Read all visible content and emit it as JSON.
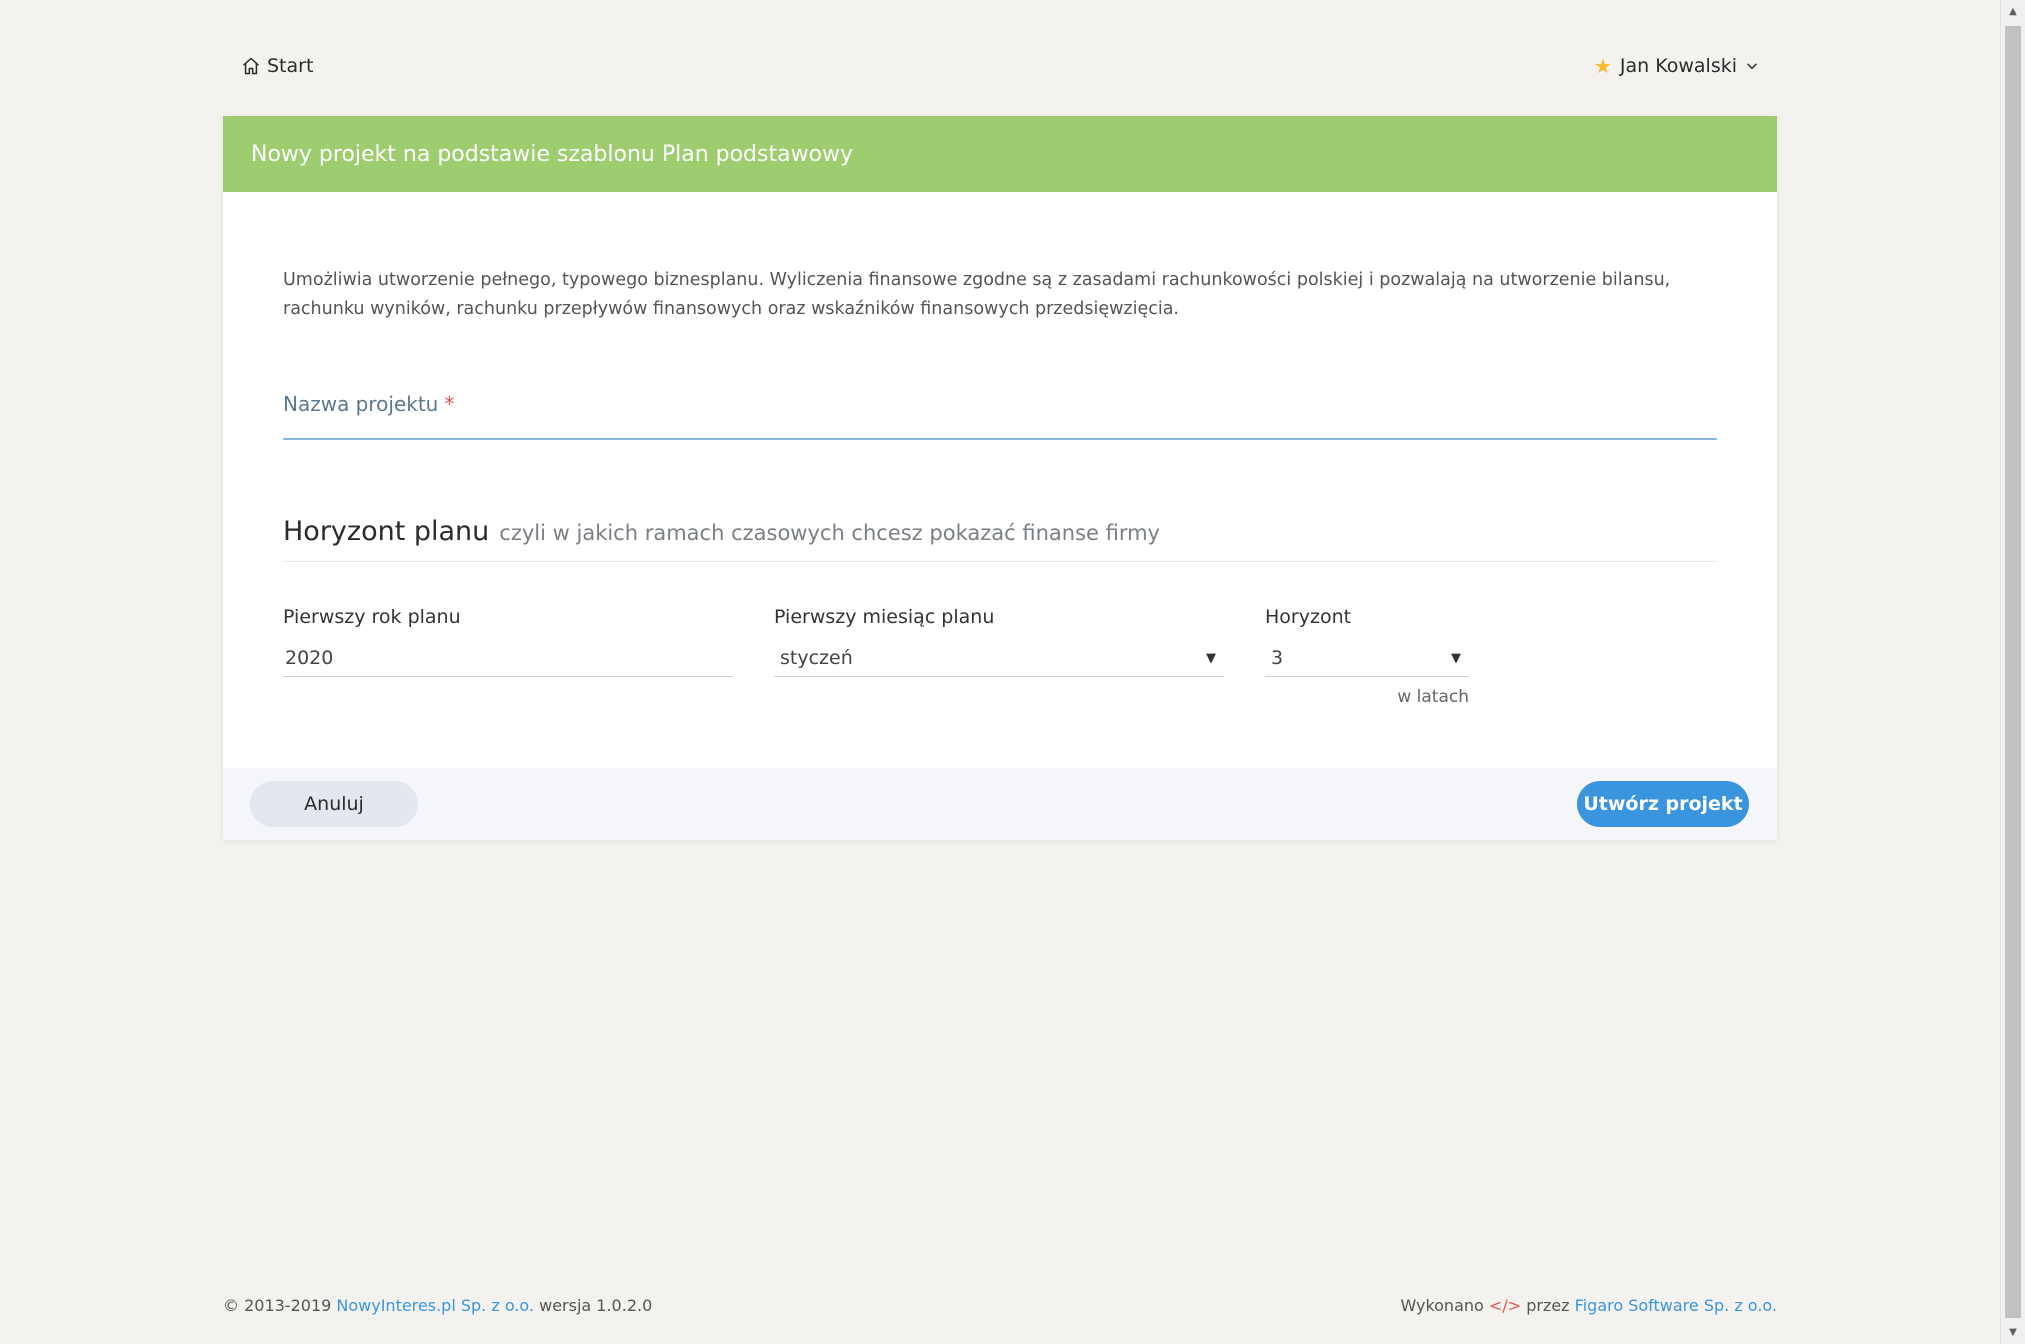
{
  "nav": {
    "home_label": "Start",
    "home_icon": "home-icon",
    "user_name": "Jan Kowalski",
    "user_icon": "star-icon",
    "user_menu_icon": "chevron-down-icon"
  },
  "card": {
    "header_title": "Nowy projekt na podstawie szablonu Plan podstawowy",
    "description": "Umożliwia utworzenie pełnego, typowego biznesplanu. Wyliczenia finansowe zgodne są z zasadami rachunkowości polskiej i pozwalają na utworzenie bilansu, rachunku wyników, rachunku przepływów finansowych oraz wskaźników finansowych przedsięwzięcia.",
    "project_name": {
      "label": "Nazwa projektu",
      "required_mark": "*",
      "value": ""
    },
    "section": {
      "title": "Horyzont planu",
      "subtitle": "czyli w jakich ramach czasowych chcesz pokazać finanse firmy"
    },
    "fields": {
      "first_year": {
        "label": "Pierwszy rok planu",
        "value": "2020"
      },
      "first_month": {
        "label": "Pierwszy miesiąc planu",
        "value": "styczeń"
      },
      "horizon": {
        "label": "Horyzont",
        "value": "3",
        "unit": "w latach"
      }
    },
    "buttons": {
      "cancel": "Anuluj",
      "create": "Utwórz projekt"
    }
  },
  "footer": {
    "copyright_prefix": "© 2013-2019",
    "company_link": "NowyInteres.pl Sp. z o.o.",
    "version": "wersja 1.0.2.0",
    "made_prefix": "Wykonano",
    "code_icon": "</>",
    "made_by": "przez",
    "vendor_link": "Figaro Software Sp. z o.o."
  },
  "colors": {
    "header_green": "#9dcd6f",
    "primary_blue": "#3b95de",
    "page_bg": "#f4f2ef",
    "star": "#f5b82e",
    "required": "#e25454"
  }
}
